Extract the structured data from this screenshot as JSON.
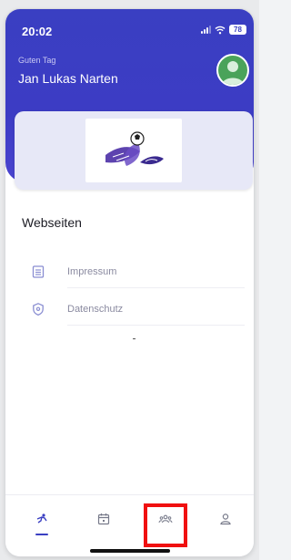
{
  "status_bar": {
    "time": "20:02",
    "battery": "78"
  },
  "header": {
    "greeting": "Guten Tag",
    "user_name": "Jan Lukas Narten"
  },
  "section": {
    "title": "Webseiten",
    "items": [
      {
        "label": "Impressum",
        "icon": "document-icon"
      },
      {
        "label": "Datenschutz",
        "icon": "shield-icon"
      }
    ]
  },
  "bottom_nav": {
    "items": [
      {
        "name": "home",
        "icon": "player-icon",
        "active": true
      },
      {
        "name": "calendar",
        "icon": "calendar-icon",
        "active": false
      },
      {
        "name": "team",
        "icon": "team-icon",
        "active": false
      },
      {
        "name": "profile",
        "icon": "person-icon",
        "active": false
      }
    ]
  },
  "colors": {
    "primary": "#3a3fc2",
    "highlight": "#f01010"
  }
}
